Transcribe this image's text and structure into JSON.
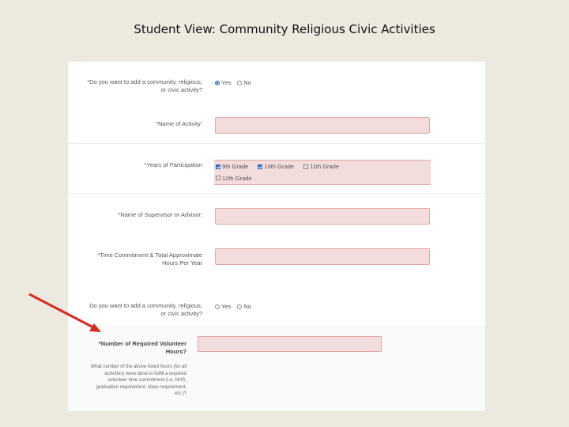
{
  "slide": {
    "title": "Student View: Community Religious Civic Activities"
  },
  "form": {
    "q1": {
      "label_line1": "*Do you want to add a community, religious,",
      "label_line2": "or civic activity?",
      "yes": "Yes",
      "no": "No",
      "selected": "yes"
    },
    "name": {
      "label": "*Name of Activity:"
    },
    "years": {
      "label": "*Years of Participation",
      "options": [
        {
          "label": "9th Grade",
          "checked": true
        },
        {
          "label": "10th Grade",
          "checked": true
        },
        {
          "label": "11th Grade",
          "checked": false
        },
        {
          "label": "12th Grade",
          "checked": false
        }
      ]
    },
    "supervisor": {
      "label": "*Name of Supervisor or Advisor:"
    },
    "time": {
      "label_line1": "*Time Commitment & Total Approximate",
      "label_line2": "Hours Per Year"
    },
    "q2": {
      "label_line1": "Do you want to add a community, religious,",
      "label_line2": "or civic activity?",
      "yes": "Yes",
      "no": "No",
      "selected": "none"
    },
    "volunteer": {
      "label_line1": "*Number of Required Volunteer",
      "label_line2": "Hours?",
      "help": [
        "What number of the above listed hours (for all",
        "activities) were done to fulfill a required",
        "volunteer time commitment (i.e. NHS,",
        "graduation requirement, class requirement,",
        "etc.)?"
      ]
    }
  },
  "colors": {
    "arrow": "#d9281f",
    "field_bg": "#f3dcdc",
    "field_border": "#e2a6a6",
    "accent": "#2a6ebb"
  }
}
